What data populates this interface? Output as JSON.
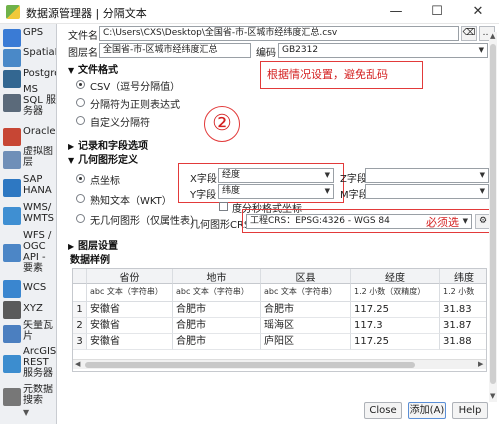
{
  "window": {
    "title": "数据源管理器 | 分隔文本",
    "minimize": "—",
    "maximize": "☐",
    "close": "✕"
  },
  "sidebar": {
    "items": [
      {
        "label": "GPS",
        "icon": "gps-icon",
        "color": "#3a7bd5"
      },
      {
        "label": "SpatiaL",
        "icon": "spatialite-icon",
        "color": "#4a89c8"
      },
      {
        "label": "Postgre",
        "icon": "postgresql-icon",
        "color": "#336791"
      },
      {
        "label": "MS\nSQL 服\n务器",
        "icon": "mssql-icon",
        "color": "#5b6a7a"
      },
      {
        "label": "Oracle",
        "icon": "oracle-icon",
        "color": "#c74634"
      },
      {
        "label": "虚拟图\n层",
        "icon": "virtual-layer-icon",
        "color": "#6f8fb8"
      },
      {
        "label": "SAP\nHANA",
        "icon": "sap-hana-icon",
        "color": "#2e78c2"
      },
      {
        "label": "WMS/\nWMTS",
        "icon": "wms-icon",
        "color": "#3f8fd2"
      },
      {
        "label": "WFS /\nOGC\nAPI -\n要素",
        "icon": "wfs-icon",
        "color": "#4c86c6"
      },
      {
        "label": "WCS",
        "icon": "wcs-icon",
        "color": "#3a86cf"
      },
      {
        "label": "XYZ",
        "icon": "xyz-icon",
        "color": "#5a5a5a"
      },
      {
        "label": "矢量瓦\n片",
        "icon": "vector-tile-icon",
        "color": "#4b7fc0"
      },
      {
        "label": "ArcGIS\nREST\n服务器",
        "icon": "arcgis-icon",
        "color": "#3c8dcf"
      },
      {
        "label": "元数据\n搜索",
        "icon": "metadata-search-icon",
        "color": "#777"
      }
    ]
  },
  "form": {
    "file_name_label": "文件名",
    "file_name_value": "C:\\Users\\CXS\\Desktop\\全国省-市-区城市经纬度汇总.csv",
    "layer_name_label": "图层名",
    "layer_name_value": "全国省-市-区城市经纬度汇总",
    "encoding_label": "编码",
    "encoding_value": "GB2312",
    "file_format_header": "文件格式",
    "format_options": [
      "CSV（逗号分隔值）",
      "分隔符为正则表达式",
      "自定义分隔符"
    ],
    "records_header": "记录和字段选项",
    "geometry_header": "几何图形定义",
    "geometry_options": [
      "点坐标",
      "熟知文本（WKT）",
      "无几何图形（仅属性表）"
    ],
    "x_field_label": "X字段",
    "x_field_value": "经度",
    "y_field_label": "Y字段",
    "y_field_value": "纬度",
    "z_field_label": "Z字段",
    "m_field_label": "M字段",
    "dms_label": "度分秒格式坐标",
    "crs_label": "几何图形CRS",
    "crs_value": "工程CRS：EPSG:4326 - WGS 84",
    "layer_settings_header": "图层设置",
    "sample_data_header": "数据样例"
  },
  "annotations": {
    "hint": "根据情况设置，避免乱码",
    "step": "②",
    "must_select": "必须选"
  },
  "table": {
    "columns": [
      "",
      "省份",
      "地市",
      "区县",
      "经度",
      "纬度"
    ],
    "types": [
      "",
      "abc 文本（字符串）",
      "abc 文本（字符串）",
      "abc 文本（字符串）",
      "1.2 小数（双精度）",
      "1.2 小数"
    ],
    "rows": [
      [
        "1",
        "安徽省",
        "合肥市",
        "合肥市",
        "117.25",
        "31.83"
      ],
      [
        "2",
        "安徽省",
        "合肥市",
        "瑶海区",
        "117.3",
        "31.87"
      ],
      [
        "3",
        "安徽省",
        "合肥市",
        "庐阳区",
        "117.25",
        "31.88"
      ]
    ]
  },
  "buttons": {
    "close": "Close",
    "add": "添加(A)",
    "help": "Help"
  }
}
